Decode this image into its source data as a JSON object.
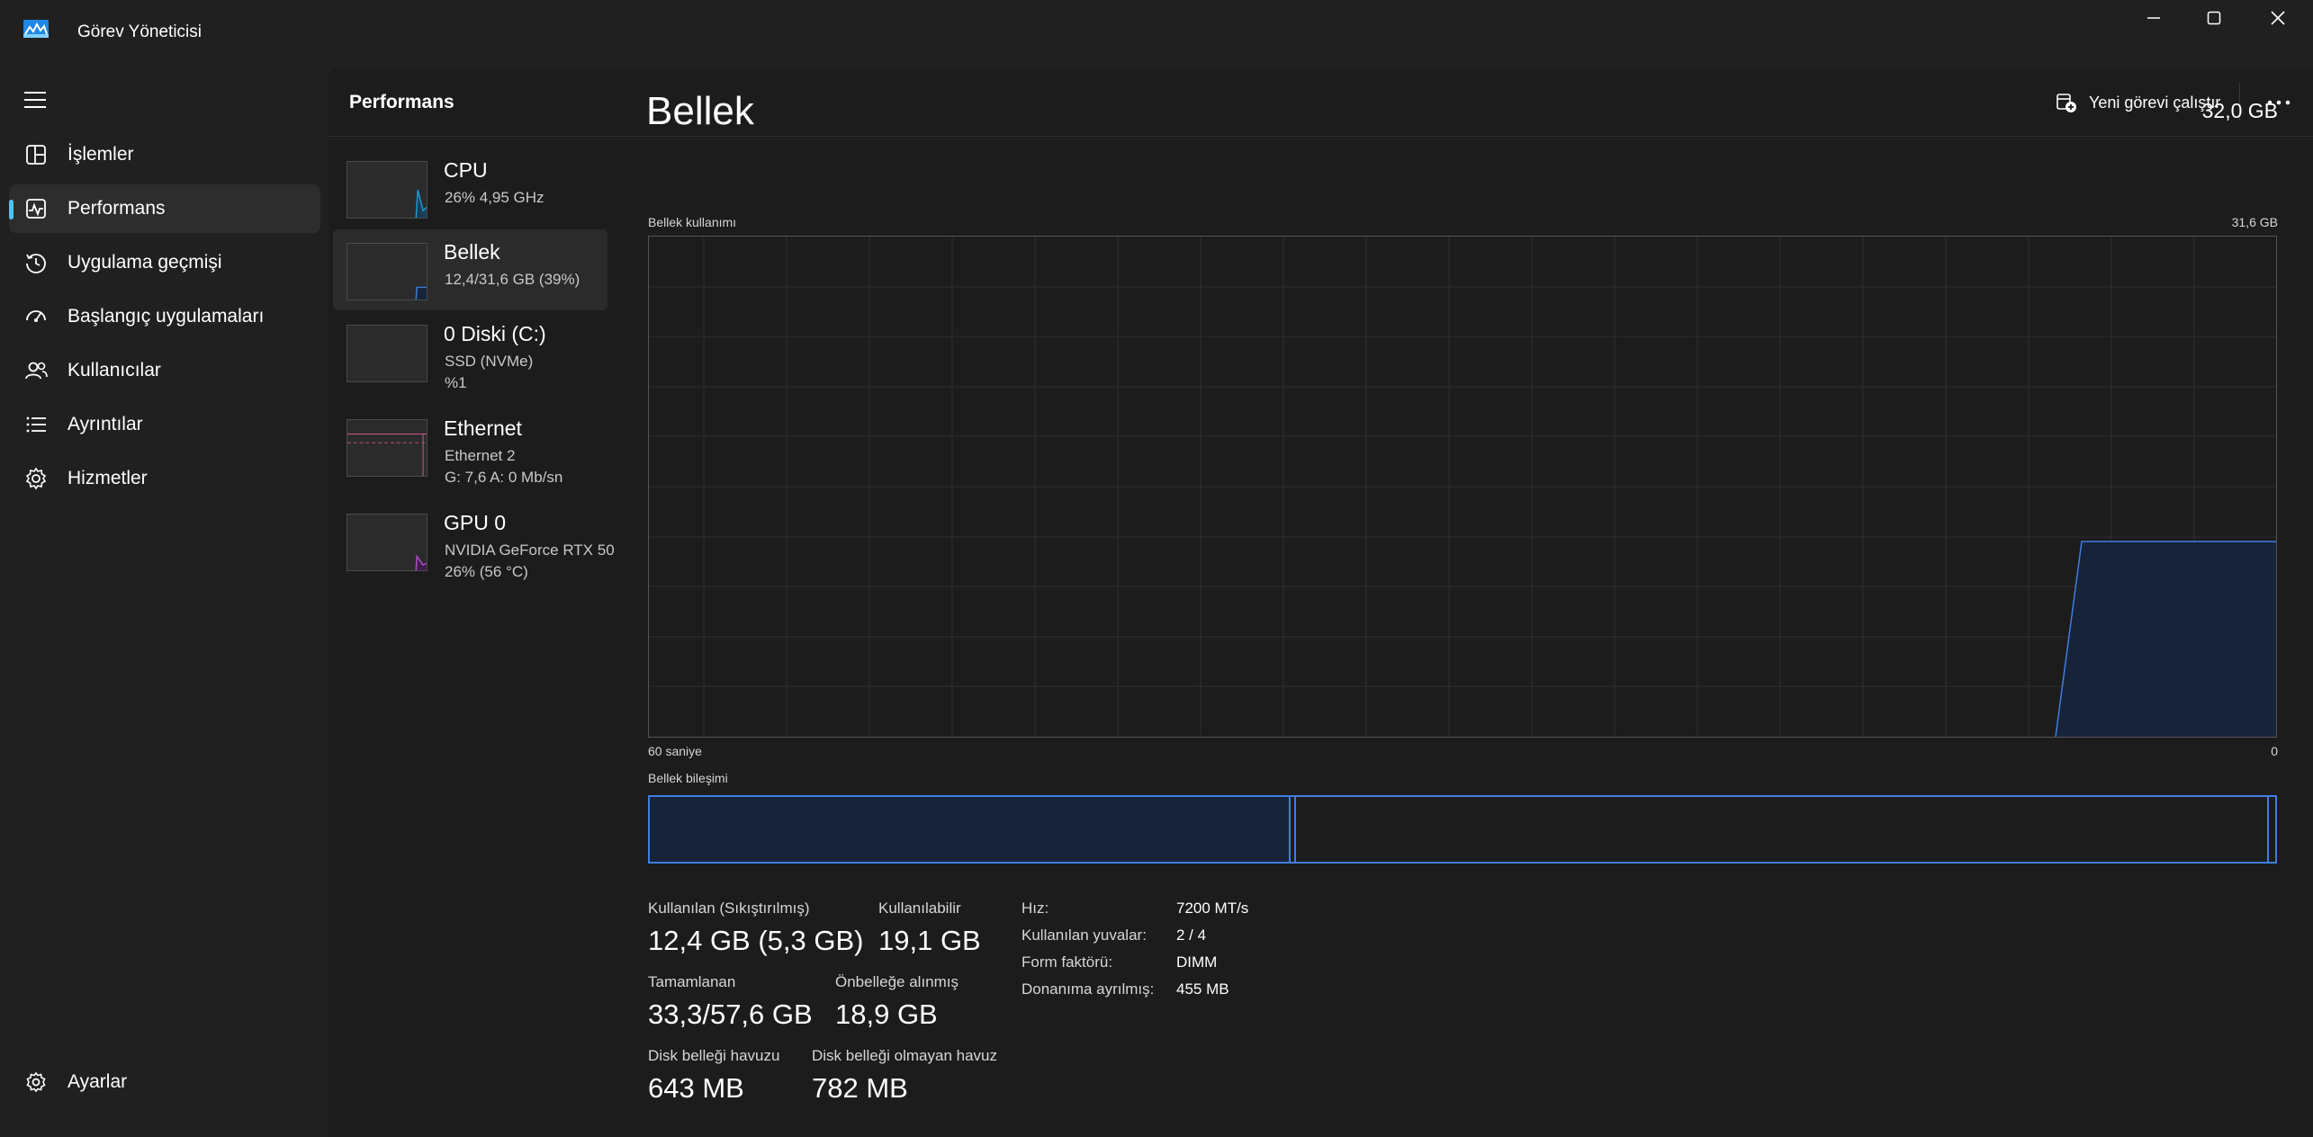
{
  "window": {
    "title": "Görev Yöneticisi",
    "accent": "#4cc2ff"
  },
  "nav": {
    "items": [
      {
        "label": "İşlemler",
        "icon": "processes-icon"
      },
      {
        "label": "Performans",
        "icon": "performance-icon",
        "active": true
      },
      {
        "label": "Uygulama geçmişi",
        "icon": "history-icon"
      },
      {
        "label": "Başlangıç uygulamaları",
        "icon": "startup-icon"
      },
      {
        "label": "Kullanıcılar",
        "icon": "users-icon"
      },
      {
        "label": "Ayrıntılar",
        "icon": "details-icon"
      },
      {
        "label": "Hizmetler",
        "icon": "services-icon"
      }
    ],
    "settings_label": "Ayarlar"
  },
  "header": {
    "title": "Performans",
    "run_new_task": "Yeni görevi çalıştır",
    "more_icon": "more-icon"
  },
  "devices": [
    {
      "name": "CPU",
      "line1": "26%  4,95 GHz",
      "line2": "",
      "color": "#1c9ad6"
    },
    {
      "name": "Bellek",
      "line1": "12,4/31,6 GB (39%)",
      "line2": "",
      "color": "#3f7de0",
      "selected": true
    },
    {
      "name": "0 Diski (C:)",
      "line1": "SSD (NVMe)",
      "line2": "%1",
      "color": "#4caf50"
    },
    {
      "name": "Ethernet",
      "line1": "Ethernet 2",
      "line2": "G: 7,6  A: 0 Mb/sn",
      "color": "#c85a8a"
    },
    {
      "name": "GPU 0",
      "line1": "NVIDIA GeForce RTX 50",
      "line2": "26%  (56 °C)",
      "color": "#b04fc8"
    }
  ],
  "memory": {
    "title": "Bellek",
    "total": "32,0 GB",
    "usage_label": "Bellek kullanımı",
    "usage_max": "31,6 GB",
    "time_left": "60 saniye",
    "time_right": "0",
    "composition_label": "Bellek bileşimi",
    "current_usage_fraction": 0.39,
    "stats": {
      "in_use_label": "Kullanılan (Sıkıştırılmış)",
      "in_use_value": "12,4 GB (5,3 GB)",
      "available_label": "Kullanılabilir",
      "available_value": "19,1 GB",
      "committed_label": "Tamamlanan",
      "committed_value": "33,3/57,6 GB",
      "cached_label": "Önbelleğe alınmış",
      "cached_value": "18,9 GB",
      "paged_label": "Disk belleği havuzu",
      "paged_value": "643 MB",
      "nonpaged_label": "Disk belleği olmayan havuz",
      "nonpaged_value": "782 MB"
    },
    "specs": {
      "speed_key": "Hız:",
      "speed_val": "7200 MT/s",
      "slots_key": "Kullanılan yuvalar:",
      "slots_val": "2 / 4",
      "form_key": "Form faktörü:",
      "form_val": "DIMM",
      "reserved_key": "Donanıma ayrılmış:",
      "reserved_val": "455 MB"
    }
  }
}
